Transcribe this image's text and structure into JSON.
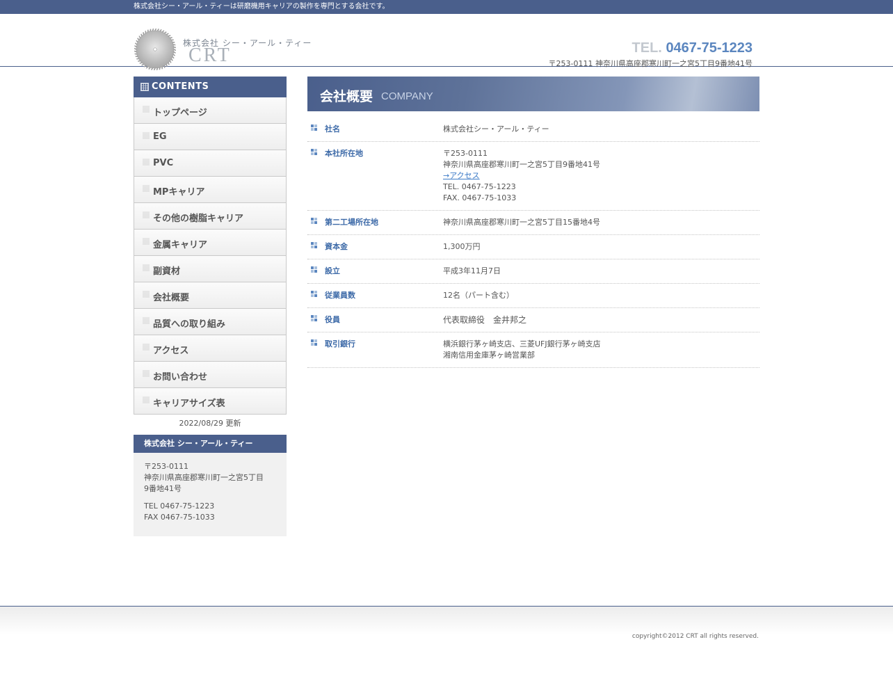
{
  "topbar": {
    "tagline": "株式会社シー・アール・ティーは研磨機用キャリアの製作を専門とする会社です。"
  },
  "header": {
    "logo_company": "株式会社 シー・アール・ティー",
    "logo_mark": "CRT",
    "tel_label": "TEL.",
    "tel_number": "0467-75-1223",
    "address": "〒253-0111 神奈川県高座郡寒川町一之宮5丁目9番地41号"
  },
  "sidebar": {
    "contents_title": "CONTENTS",
    "nav": [
      {
        "label": "トップページ"
      },
      {
        "label": "EG"
      },
      {
        "label": "PVC"
      },
      {
        "label": "MPキャリア"
      },
      {
        "label": "その他の樹脂キャリア"
      },
      {
        "label": "金属キャリア"
      },
      {
        "label": "副資材"
      },
      {
        "label": "会社概要"
      },
      {
        "label": "品質への取り組み"
      },
      {
        "label": "アクセス"
      },
      {
        "label": "お問い合わせ"
      },
      {
        "label": "キャリアサイズ表"
      }
    ],
    "updated": "2022/08/29 更新",
    "info": {
      "title": "株式会社 シー・アール・ティー",
      "postal": "〒253-0111",
      "address_line1": "神奈川県高座郡寒川町一之宮5丁目",
      "address_line2": "9番地41号",
      "tel": "TEL 0467-75-1223",
      "fax": "FAX 0467-75-1033"
    }
  },
  "main": {
    "heading_jp": "会社概要",
    "heading_en": "COMPANY",
    "rows": {
      "name": {
        "key": "社名",
        "value": "株式会社シー・アール・ティー"
      },
      "hq": {
        "key": "本社所在地",
        "postal": "〒253-0111",
        "address": "神奈川県高座郡寒川町一之宮5丁目9番地41号",
        "access_link": "→アクセス",
        "tel": "TEL. 0467-75-1223",
        "fax": "FAX. 0467-75-1033"
      },
      "factory2": {
        "key": "第二工場所在地",
        "value": "神奈川県高座郡寒川町一之宮5丁目15番地4号"
      },
      "capital": {
        "key": "資本金",
        "value": "1,300万円"
      },
      "founded": {
        "key": "設立",
        "value": "平成3年11月7日"
      },
      "employees": {
        "key": "従業員数",
        "value": "12名（パート含む）"
      },
      "officers": {
        "key": "役員",
        "value": "代表取締役　金井邦之"
      },
      "banks": {
        "key": "取引銀行",
        "line1": "横浜銀行茅ヶ崎支店、三菱UFJ銀行茅ヶ崎支店",
        "line2": "湘南信用金庫茅ヶ崎営業部"
      }
    }
  },
  "footer": {
    "copyright": "copyright©2012 CRT all rights reserved."
  },
  "colors": {
    "brand_navy": "#4a5f8c",
    "accent_blue": "#5b86bf",
    "link_blue": "#3d7bc7"
  }
}
